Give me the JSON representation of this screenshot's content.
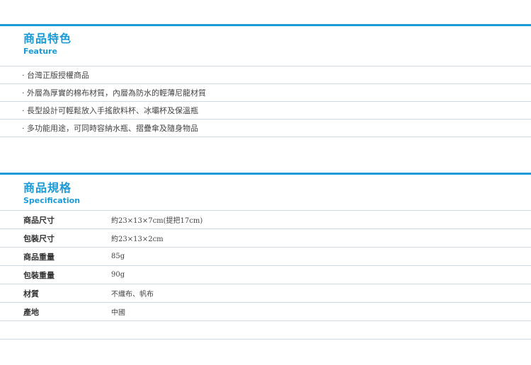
{
  "feature": {
    "title": "商品特色",
    "subtitle": "Feature",
    "items": [
      "台灣正版授權商品",
      "外層為厚實的棉布材質，內層為防水的輕薄尼龍材質",
      "長型設計可輕鬆放入手搖飲料杯、冰壩杯及保溫瓶",
      "多功能用途，可同時容納水瓶、摺疊傘及隨身物品"
    ]
  },
  "spec": {
    "title": "商品規格",
    "subtitle": "Specification",
    "rows": [
      {
        "label": "商品尺寸",
        "value": "約23×13×7cm(提把17cm)"
      },
      {
        "label": "包裝尺寸",
        "value": "約23×13×2cm"
      },
      {
        "label": "商品重量",
        "value": "85g"
      },
      {
        "label": "包裝重量",
        "value": "90g"
      },
      {
        "label": "材質",
        "value": "不織布、帆布"
      },
      {
        "label": "產地",
        "value": "中國"
      }
    ]
  },
  "colors": {
    "accent": "#1a9ad6",
    "divider": "#cfd8de"
  }
}
